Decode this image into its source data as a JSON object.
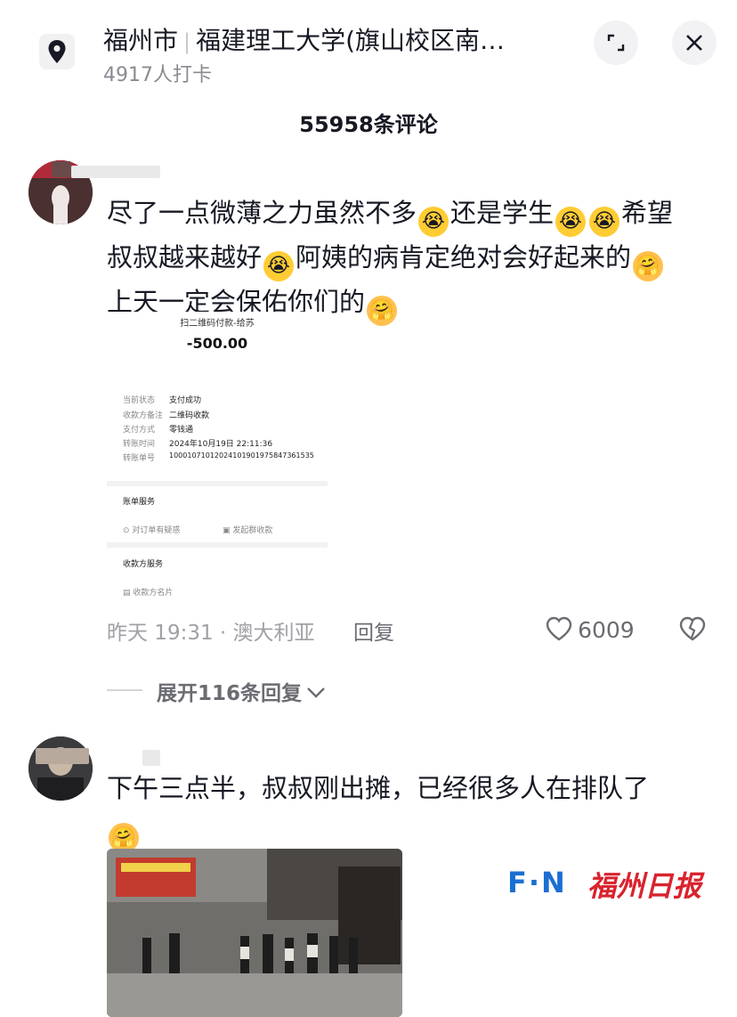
{
  "header": {
    "city": "福州市",
    "place": "福建理工大学(旗山校区南…",
    "checkins": "4917人打卡"
  },
  "comment_count": "55958条评论",
  "comments": [
    {
      "text_lines": [
        "尽了一点微薄之力虽然不多",
        "还是学生",
        "希望",
        "叔叔越来越好",
        "阿姨的病肯定绝对会好起来的",
        "上天一定会保佑你们的"
      ],
      "receipt": {
        "title": "扫二维码付款-给苏",
        "amount": "-500.00",
        "rows": [
          {
            "label": "当前状态",
            "value": "支付成功"
          },
          {
            "label": "收款方备注",
            "value": "二维码收款"
          },
          {
            "label": "支付方式",
            "value": "零钱通"
          },
          {
            "label": "转账时间",
            "value": "2024年10月19日 22:11:36"
          },
          {
            "label": "转账单号",
            "value": "100010710120241019019758473​61535"
          }
        ],
        "service_title": "账单服务",
        "action1": "对订单有疑惑",
        "action2": "发起群收款",
        "payee_title": "收款方服务",
        "payee_card": "收款方名片"
      },
      "meta": "昨天 19:31 · 澳大利亚",
      "reply": "回复",
      "likes": "6009",
      "expand": "展开116条回复"
    },
    {
      "text_line1": "下午三点半，叔叔刚出摊，已经很多人在排队了"
    }
  ],
  "watermark": {
    "latin": "F·N",
    "cn": "福州日报"
  },
  "icons": [
    "location-pin-icon",
    "expand-icon",
    "close-icon",
    "heart-icon",
    "broken-heart-icon",
    "chevron-down-icon"
  ],
  "colors": {
    "accent": "#1b6fd1",
    "brand_red": "#d9232e",
    "text": "#161823",
    "muted": "#8a8b91"
  }
}
